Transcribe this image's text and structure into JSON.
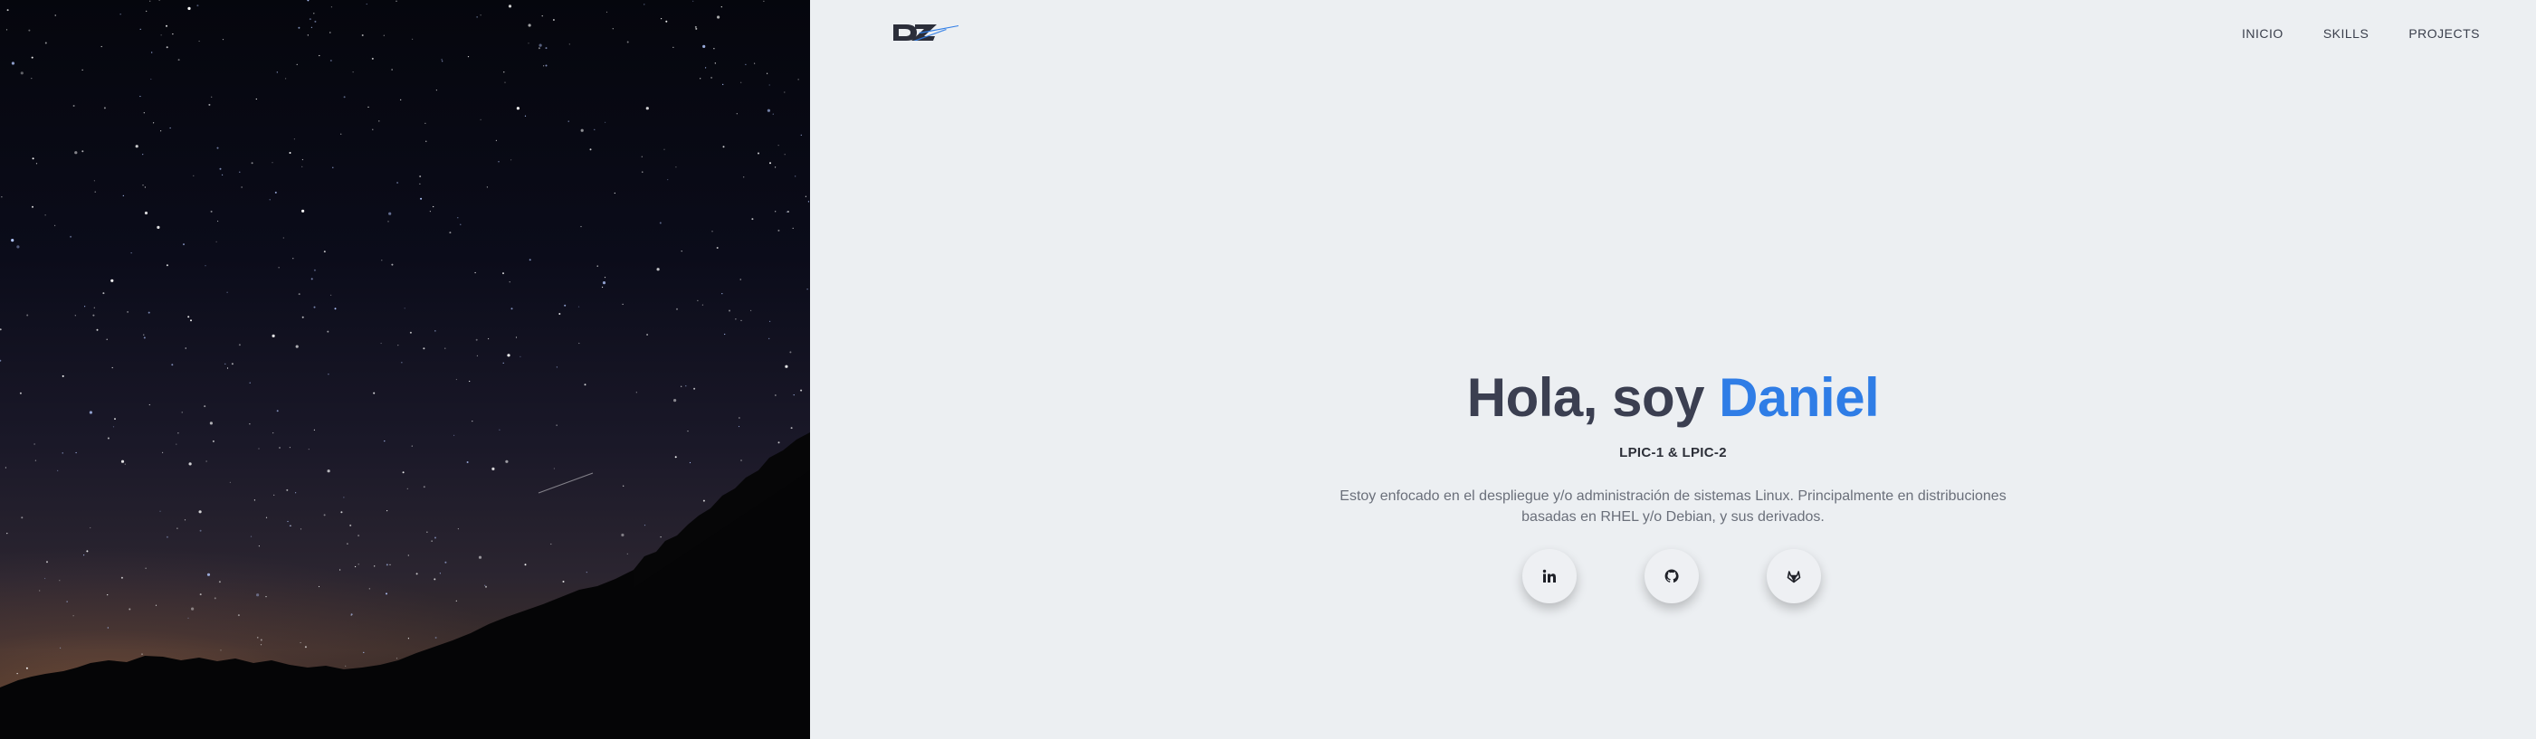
{
  "nav": {
    "logo_text": "DZ",
    "items": [
      {
        "label": "INICIO"
      },
      {
        "label": "SKILLS"
      },
      {
        "label": "PROJECTS"
      }
    ]
  },
  "hero": {
    "greeting": "Hola, soy",
    "name": "Daniel",
    "certs": "LPIC-1 & LPIC-2",
    "description": "Estoy enfocado en el despliegue y/o administración de sistemas Linux. Principalmente en distribuciones basadas en RHEL y/o Debian, y sus derivados."
  },
  "social": [
    {
      "icon": "linkedin-icon"
    },
    {
      "icon": "github-icon"
    },
    {
      "icon": "gitlab-icon"
    }
  ],
  "colors": {
    "accent": "#2f7de6",
    "heading": "#3b3f51",
    "background": "#eceff2"
  }
}
